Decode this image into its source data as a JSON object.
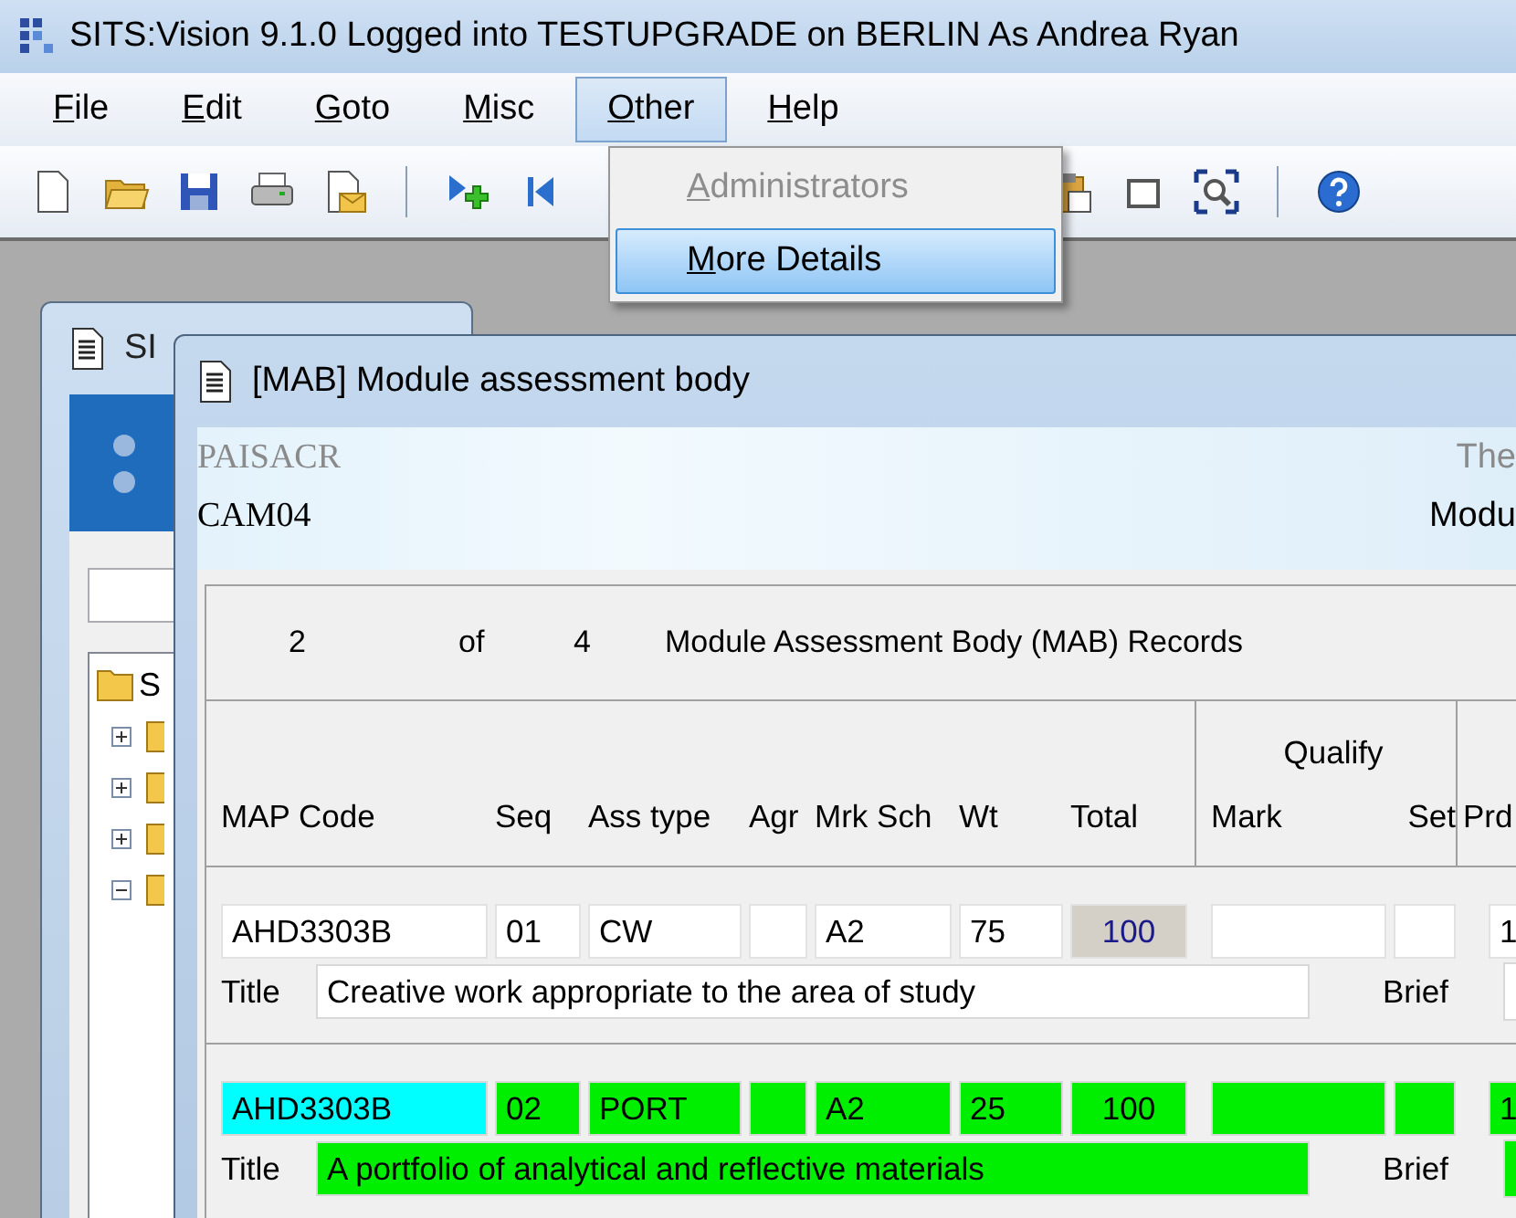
{
  "window": {
    "title": "SITS:Vision 9.1.0 Logged into TESTUPGRADE on BERLIN As Andrea Ryan"
  },
  "menu_bar": [
    {
      "label": "File",
      "selected": false
    },
    {
      "label": "Edit",
      "selected": false
    },
    {
      "label": "Goto",
      "selected": false
    },
    {
      "label": "Misc",
      "selected": false
    },
    {
      "label": "Other",
      "selected": true
    },
    {
      "label": "Help",
      "selected": false
    }
  ],
  "open_menu": [
    {
      "label": "Administrators",
      "disabled": true,
      "selected": false
    },
    {
      "label": "More Details",
      "disabled": false,
      "selected": true
    }
  ],
  "back_window": {
    "title": "SI",
    "tree": {
      "label": "S",
      "children": [
        {
          "expanded": false
        },
        {
          "expanded": false
        },
        {
          "expanded": false
        },
        {
          "expanded": true
        }
      ]
    }
  },
  "front_window": {
    "title": "[MAB] Module assessment body",
    "header": {
      "top_left": "PAISACR",
      "bottom_left": "CAM04",
      "top_right": "The",
      "bottom_right": "Modu"
    },
    "counter": {
      "current": "2",
      "of": "of",
      "total": "4",
      "label": "Module Assessment Body (MAB) Records"
    },
    "columns": [
      {
        "label": "MAP Code"
      },
      {
        "label": "Seq"
      },
      {
        "label": "Ass type"
      },
      {
        "label": "Agr"
      },
      {
        "label": "Mrk Sch"
      },
      {
        "label": "Wt"
      },
      {
        "label": "Total",
        "kind": "computed"
      },
      {
        "label": "Qualify",
        "children": [
          {
            "label": "Mark"
          },
          {
            "label": "Set"
          }
        ]
      },
      {
        "label": "Prd"
      }
    ],
    "records": [
      {
        "selected": false,
        "focused": false,
        "cells": [
          {
            "value": "AHD3303B"
          },
          {
            "value": "01"
          },
          {
            "value": "CW"
          },
          {},
          {
            "value": "A2"
          },
          {
            "value": "75"
          },
          {
            "value": "100"
          },
          {},
          {},
          {
            "value": "1"
          }
        ],
        "title_label": "Title",
        "title": "Creative work appropriate to the area of study",
        "brief_label": "Brief"
      },
      {
        "selected": true,
        "focused": true,
        "cells": [
          {
            "value": "AHD3303B"
          },
          {
            "value": "02"
          },
          {
            "value": "PORT"
          },
          {},
          {
            "value": "A2"
          },
          {
            "value": "25"
          },
          {
            "value": "100"
          },
          {},
          {},
          {
            "value": "1"
          }
        ],
        "title_label": "Title",
        "title": "A portfolio of analytical and reflective materials",
        "brief_label": "Brief"
      }
    ]
  }
}
